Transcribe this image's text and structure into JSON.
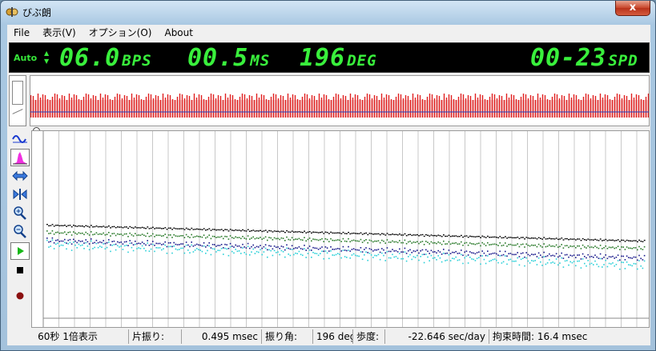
{
  "window": {
    "title": "びぶ朗",
    "close_label": "x"
  },
  "menu": {
    "items": [
      "File",
      "表示(V)",
      "オプション(O)",
      "About"
    ]
  },
  "lcd": {
    "auto_label": "Auto",
    "bps_value": "06.0",
    "bps_unit": "BPS",
    "ms_value": "00.5",
    "ms_unit": "MS",
    "deg_value": "196",
    "deg_unit": "DEG",
    "spd_value": "00-23",
    "spd_unit": "SPD"
  },
  "status": {
    "duration": "60秒 1倍表示",
    "beat_label": "片振り:",
    "beat_value": "0.495 msec",
    "amplitude_label": "振り角:",
    "amplitude_value": "196 deg",
    "rate_label": "歩度:",
    "rate_value": "-22.646 sec/day",
    "lock_label": "拘束時間: 16.4 msec"
  },
  "colors": {
    "lcd_green": "#39f03c",
    "strip_red": "#e02020",
    "strip_blue": "#2040c0",
    "trace_black": "#000000",
    "trace_green": "#2a7a2a",
    "trace_navy": "#1a1a8c",
    "trace_cyan": "#2ad0d8"
  },
  "tools": [
    {
      "name": "waveform-icon",
      "active": false
    },
    {
      "name": "histogram-icon",
      "active": true
    },
    {
      "name": "expand-horizontal-icon",
      "active": false
    },
    {
      "name": "compress-icon",
      "active": false
    },
    {
      "name": "zoom-in-icon",
      "active": false
    },
    {
      "name": "zoom-out-icon",
      "active": false
    },
    {
      "name": "play-icon",
      "active": true
    },
    {
      "name": "stop-icon",
      "active": false
    },
    {
      "name": "record-icon",
      "active": false
    }
  ]
}
